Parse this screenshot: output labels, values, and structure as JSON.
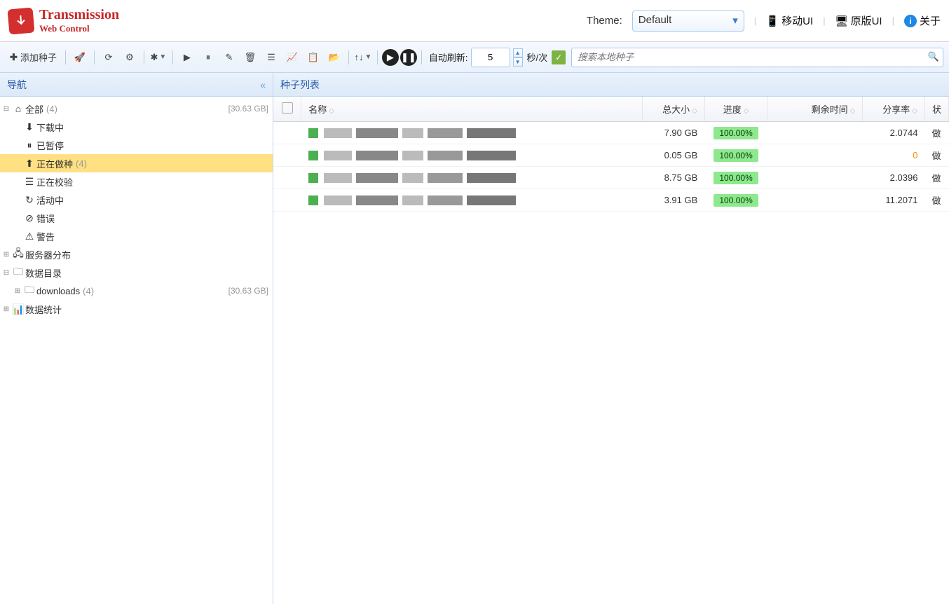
{
  "header": {
    "title": "Transmission",
    "subtitle": "Web Control",
    "theme_label": "Theme:",
    "theme_value": "Default",
    "mobile_ui": "移动UI",
    "original_ui": "原版UI",
    "about": "关于"
  },
  "toolbar": {
    "add_torrent": "添加种子",
    "auto_refresh_label": "自动刷新:",
    "refresh_interval": "5",
    "refresh_unit": "秒/次",
    "search_placeholder": "搜索本地种子"
  },
  "sidebar": {
    "title": "导航",
    "all": {
      "label": "全部",
      "count": "(4)",
      "size": "[30.63 GB]"
    },
    "downloading": "下载中",
    "paused": "已暂停",
    "seeding": {
      "label": "正在做种",
      "count": "(4)"
    },
    "checking": "正在校验",
    "active": "活动中",
    "error": "错误",
    "warning": "警告",
    "servers": "服务器分布",
    "data_dir": "数据目录",
    "downloads_folder": {
      "label": "downloads",
      "count": "(4)",
      "size": "[30.63 GB]"
    },
    "stats": "数据统计"
  },
  "main": {
    "title": "种子列表",
    "columns": {
      "name": "名称",
      "size": "总大小",
      "progress": "进度",
      "remaining": "剩余时间",
      "ratio": "分享率",
      "status": "状"
    },
    "rows": [
      {
        "size": "7.90 GB",
        "progress": "100.00%",
        "remaining": "",
        "ratio": "2.0744",
        "ratio_class": ""
      },
      {
        "size": "0.05 GB",
        "progress": "100.00%",
        "remaining": "",
        "ratio": "0",
        "ratio_class": "ratio-orange"
      },
      {
        "size": "8.75 GB",
        "progress": "100.00%",
        "remaining": "",
        "ratio": "2.0396",
        "ratio_class": ""
      },
      {
        "size": "3.91 GB",
        "progress": "100.00%",
        "remaining": "",
        "ratio": "11.2071",
        "ratio_class": ""
      }
    ]
  }
}
